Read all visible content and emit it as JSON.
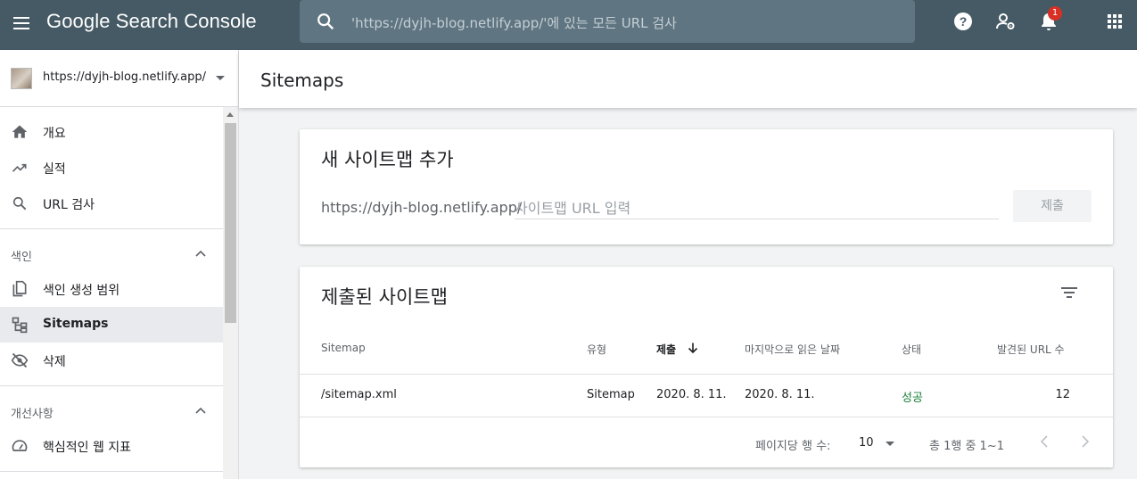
{
  "app": {
    "logo_text": "Google Search Console",
    "search_placeholder": "'https://dyjh-blog.netlify.app/'에 있는 모든 URL 검사",
    "notification_count": "1"
  },
  "sidebar": {
    "property_url": "https://dyjh-blog.netlify.app/",
    "items": [
      {
        "label": "개요",
        "icon": "home-icon"
      },
      {
        "label": "실적",
        "icon": "trending-up-icon"
      },
      {
        "label": "URL 검사",
        "icon": "search-icon"
      }
    ],
    "section_index": {
      "header": "색인",
      "items": [
        {
          "label": "색인 생성 범위",
          "icon": "file-copy-icon"
        },
        {
          "label": "Sitemaps",
          "icon": "sitemap-icon",
          "active": true
        },
        {
          "label": "삭제",
          "icon": "visibility-off-icon"
        }
      ]
    },
    "section_enhancements": {
      "header": "개선사항",
      "items": [
        {
          "label": "핵심적인 웹 지표",
          "icon": "speed-icon"
        }
      ]
    }
  },
  "page": {
    "title": "Sitemaps"
  },
  "add_sitemap": {
    "title": "새 사이트맵 추가",
    "url_prefix": "https://dyjh-blog.netlify.app/",
    "input_placeholder": "사이트맵 URL 입력",
    "input_value": "",
    "submit_label": "제출"
  },
  "submitted": {
    "title": "제출된 사이트맵",
    "columns": [
      "Sitemap",
      "유형",
      "제출",
      "마지막으로 읽은 날짜",
      "상태",
      "발견된 URL 수"
    ],
    "sorted_column": "제출",
    "rows": [
      {
        "sitemap": "/sitemap.xml",
        "type": "Sitemap",
        "submitted": "2020. 8. 11.",
        "last_read": "2020. 8. 11.",
        "status": "성공",
        "discovered_urls": "12"
      }
    ],
    "footer": {
      "rows_per_page_label": "페이지당 행 수:",
      "rows_per_page": "10",
      "range_text": "총 1행 중 1~1"
    }
  },
  "colors": {
    "topbar": "#455a64",
    "search_bg": "#5f7581",
    "success": "#188038",
    "badge": "#d93025"
  }
}
